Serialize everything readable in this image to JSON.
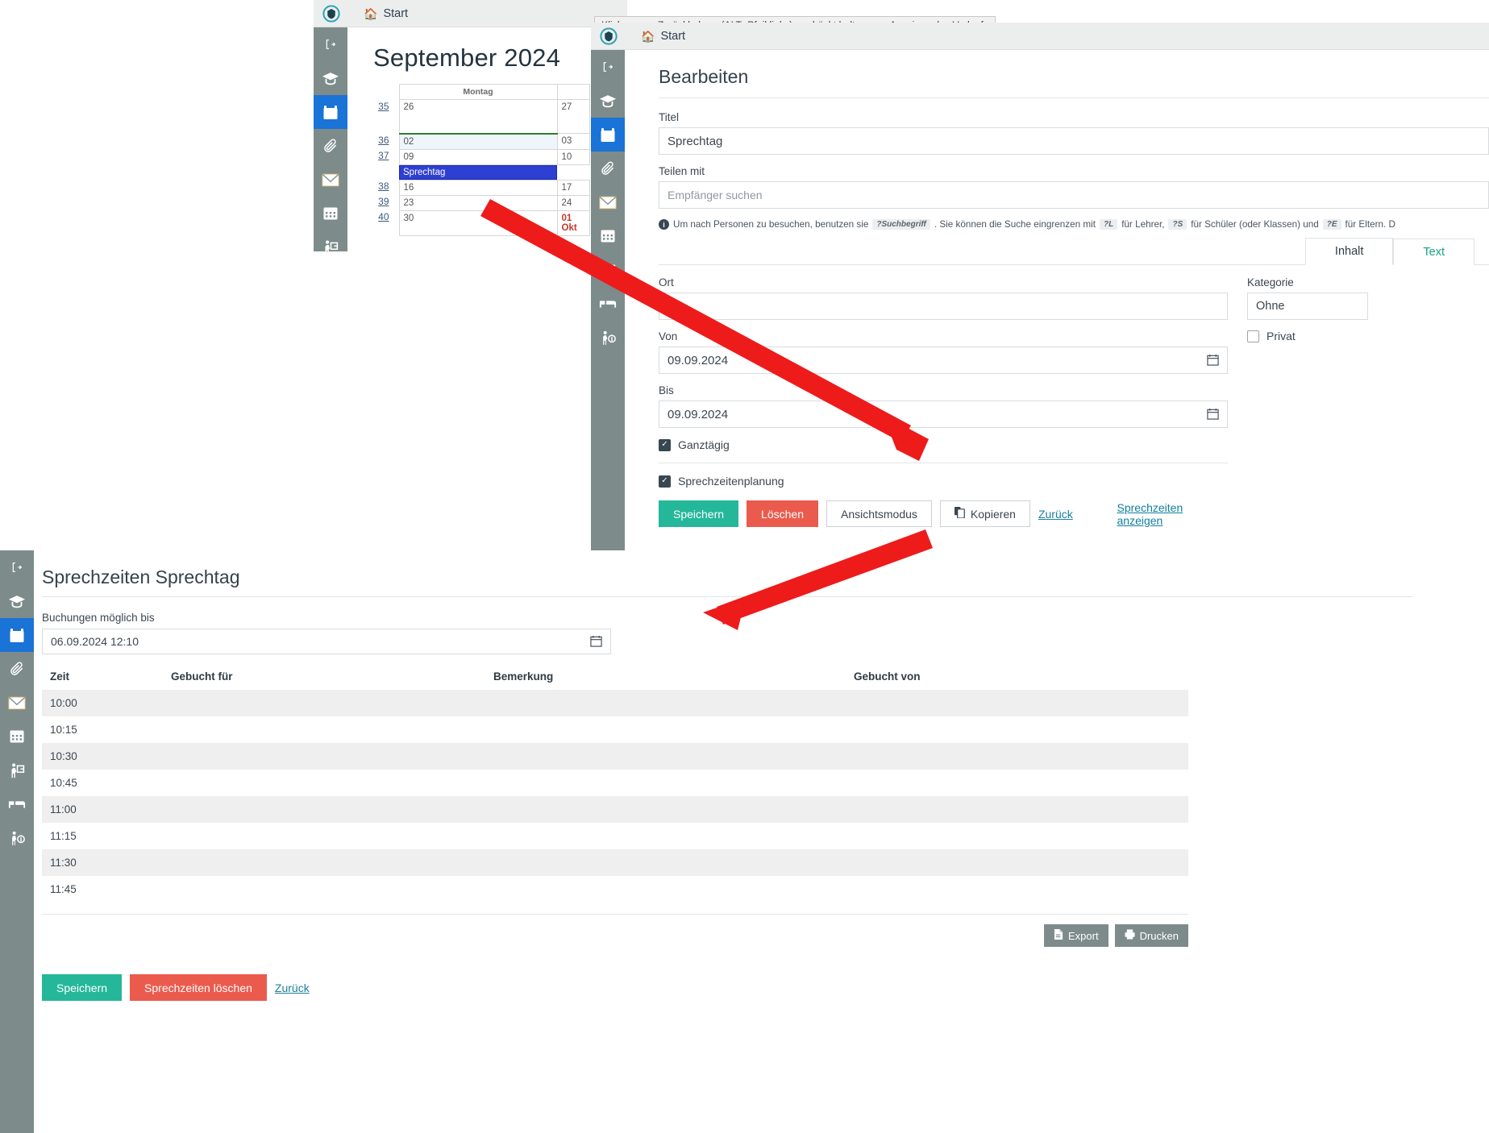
{
  "app": {
    "home_label": "Start",
    "logo_icon": "shield-logo-icon",
    "home_icon": "home-icon"
  },
  "tooltip": {
    "text": "Klicken zum Zurückkehren (ALT+Pfeil links), gedrückt halten zum Anzeigen des Verlaufs"
  },
  "sidebar": {
    "items": [
      {
        "name": "logout",
        "icon": "logout-icon"
      },
      {
        "name": "graduation",
        "icon": "graduation-cap-icon"
      },
      {
        "name": "calendar",
        "icon": "calendar-icon",
        "active": true
      },
      {
        "name": "attachments",
        "icon": "paperclip-icon"
      },
      {
        "name": "messages",
        "icon": "envelope-icon"
      },
      {
        "name": "timetable",
        "icon": "calendar-grid-icon"
      },
      {
        "name": "presentation",
        "icon": "presenter-icon"
      },
      {
        "name": "beds",
        "icon": "bed-icon"
      },
      {
        "name": "person-info",
        "icon": "person-question-icon"
      }
    ]
  },
  "calendar": {
    "title": "September 2024",
    "column_header": "Montag",
    "weeks": [
      {
        "week": "35",
        "day": "26",
        "next": "27",
        "today": false,
        "event": null
      },
      {
        "week": "36",
        "day": "02",
        "next": "03",
        "today": true,
        "event": null
      },
      {
        "week": "37",
        "day": "09",
        "next": "10",
        "today": false,
        "event": "Sprechtag"
      },
      {
        "week": "38",
        "day": "16",
        "next": "17",
        "today": false,
        "event": null
      },
      {
        "week": "39",
        "day": "23",
        "next": "24",
        "today": false,
        "event": null
      },
      {
        "week": "40",
        "day": "30",
        "next": "01 Okt",
        "today": false,
        "event": null
      }
    ],
    "event_color": "#2e3fd4",
    "today_color": "#2e7d32"
  },
  "edit": {
    "heading": "Bearbeiten",
    "title_label": "Titel",
    "title_value": "Sprechtag",
    "share_label": "Teilen mit",
    "share_placeholder": "Empfänger suchen",
    "hint": {
      "prefix": "Um nach Personen zu besuchen, benutzen sie",
      "kbd1": "?Suchbegriff",
      "mid1": ". Sie können die Suche eingrenzen mit",
      "kbd2": "?L",
      "mid2": "für Lehrer,",
      "kbd3": "?S",
      "mid3": "für Schüler (oder Klassen) und",
      "kbd4": "?E",
      "suffix": "für Eltern. D"
    },
    "tabs": [
      {
        "label": "Inhalt",
        "active": true
      },
      {
        "label": "Text",
        "active": false
      }
    ],
    "place_label": "Ort",
    "place_value": "",
    "from_label": "Von",
    "from_value": "09.09.2024",
    "to_label": "Bis",
    "to_value": "09.09.2024",
    "category_label": "Kategorie",
    "category_value": "Ohne",
    "private_label": "Privat",
    "private_checked": false,
    "allday_label": "Ganztägig",
    "allday_checked": true,
    "consult_label": "Sprechzeitenplanung",
    "consult_checked": true,
    "buttons": {
      "save": "Speichern",
      "delete": "Löschen",
      "viewmode": "Ansichtsmodus",
      "copy": "Kopieren",
      "back": "Zurück",
      "show_slots": "Sprechzeiten anzeigen"
    },
    "colors": {
      "save": "#25b79a",
      "delete": "#ea5b4e",
      "link": "#1b7f9e",
      "highlight": "#ef1d1d"
    }
  },
  "slots_page": {
    "heading": "Sprechzeiten Sprechtag",
    "until_label": "Buchungen möglich bis",
    "until_value": "06.09.2024 12:10",
    "columns": [
      "Zeit",
      "Gebucht für",
      "Bemerkung",
      "Gebucht von"
    ],
    "rows": [
      {
        "zeit": "10:00",
        "fuer": "",
        "bemerkung": "",
        "von": ""
      },
      {
        "zeit": "10:15",
        "fuer": "",
        "bemerkung": "",
        "von": ""
      },
      {
        "zeit": "10:30",
        "fuer": "",
        "bemerkung": "",
        "von": ""
      },
      {
        "zeit": "10:45",
        "fuer": "",
        "bemerkung": "",
        "von": ""
      },
      {
        "zeit": "11:00",
        "fuer": "",
        "bemerkung": "",
        "von": ""
      },
      {
        "zeit": "11:15",
        "fuer": "",
        "bemerkung": "",
        "von": ""
      },
      {
        "zeit": "11:30",
        "fuer": "",
        "bemerkung": "",
        "von": ""
      },
      {
        "zeit": "11:45",
        "fuer": "",
        "bemerkung": "",
        "von": ""
      }
    ],
    "export_label": "Export",
    "print_label": "Drucken",
    "save_label": "Speichern",
    "delete_slots_label": "Sprechzeiten löschen",
    "back_label": "Zurück"
  }
}
